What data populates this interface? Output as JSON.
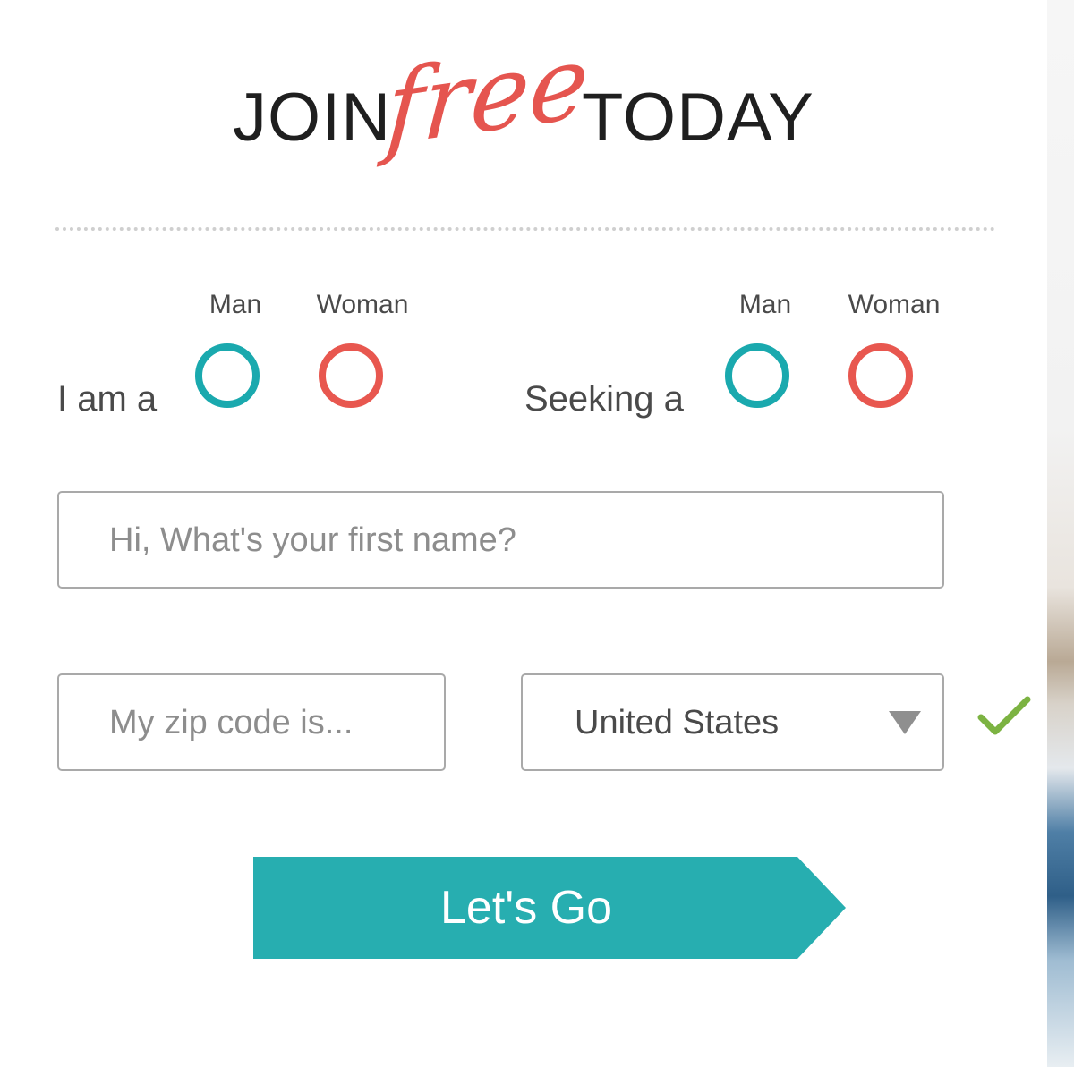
{
  "headline": {
    "join": "JOIN",
    "free": "free",
    "today": "TODAY"
  },
  "i_am": {
    "label": "I am a",
    "options": [
      {
        "label": "Man"
      },
      {
        "label": "Woman"
      }
    ]
  },
  "seeking": {
    "label": "Seeking a",
    "options": [
      {
        "label": "Man"
      },
      {
        "label": "Woman"
      }
    ]
  },
  "first_name": {
    "placeholder": "Hi, What's your first name?"
  },
  "zip": {
    "placeholder": "My zip code is..."
  },
  "country": {
    "value": "United States"
  },
  "submit": {
    "label": "Let's Go"
  },
  "colors": {
    "teal": "#1aa9ae",
    "coral": "#e8574f",
    "button": "#27aeb0",
    "check": "#7cb342"
  },
  "icons": {
    "country_dropdown": "caret-down-icon",
    "valid": "checkmark-icon"
  }
}
